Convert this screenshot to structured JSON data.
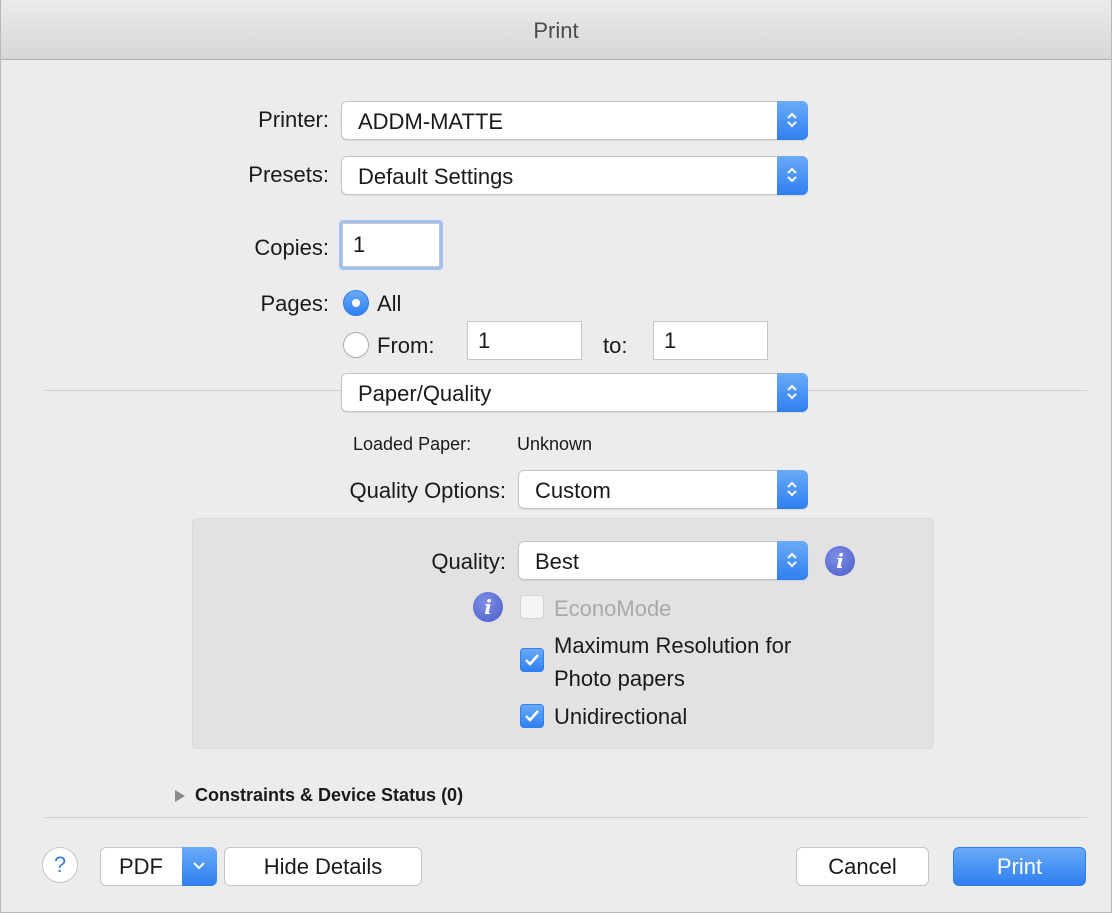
{
  "window": {
    "title": "Print"
  },
  "printer": {
    "label": "Printer:",
    "value": "ADDM-MATTE"
  },
  "presets": {
    "label": "Presets:",
    "value": "Default Settings"
  },
  "copies": {
    "label": "Copies:",
    "value": "1"
  },
  "pages": {
    "label": "Pages:",
    "all_label": "All",
    "from_label": "From:",
    "from_value": "1",
    "to_label": "to:",
    "to_value": "1",
    "selected": "All"
  },
  "panel_select": {
    "value": "Paper/Quality"
  },
  "loaded_paper": {
    "label": "Loaded Paper:",
    "value": "Unknown"
  },
  "quality_options": {
    "label": "Quality Options:",
    "value": "Custom"
  },
  "quality": {
    "label": "Quality:",
    "value": "Best"
  },
  "options": {
    "econo_mode": {
      "label": "EconoMode",
      "checked": false,
      "enabled": false
    },
    "max_resolution": {
      "label_line1": "Maximum Resolution for",
      "label_line2": "Photo papers",
      "checked": true
    },
    "unidirectional": {
      "label": "Unidirectional",
      "checked": true
    }
  },
  "constraints": {
    "label": "Constraints & Device Status (0)"
  },
  "footer": {
    "help_glyph": "?",
    "pdf_label": "PDF",
    "hide_details_label": "Hide Details",
    "cancel_label": "Cancel",
    "print_label": "Print"
  },
  "colors": {
    "accent": "#2f7ff0",
    "info_icon": "#4a5bc9",
    "panel_bg": "#e2e2e2",
    "window_bg": "#ececec"
  }
}
